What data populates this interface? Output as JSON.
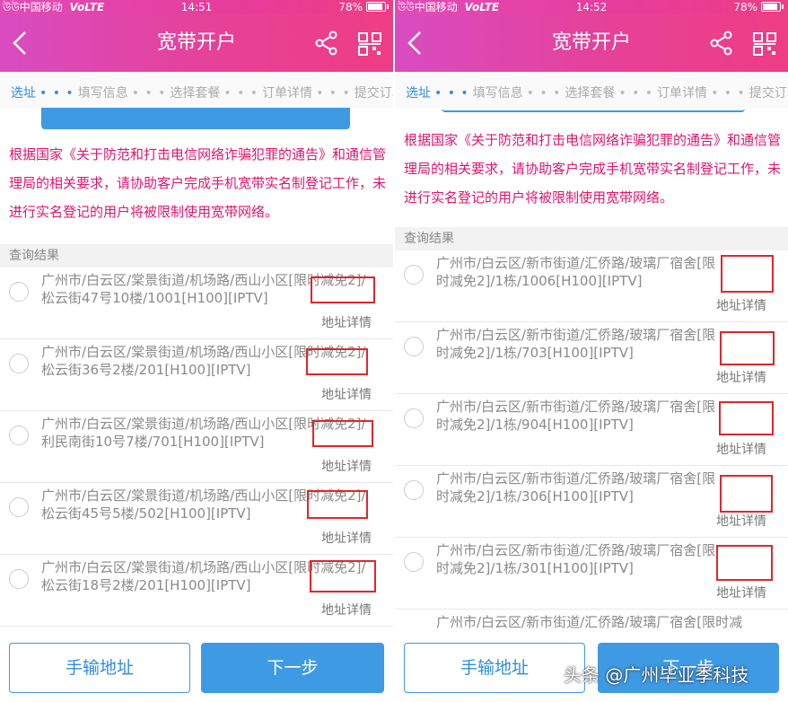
{
  "left": {
    "status": {
      "signal": "উউ中国移动",
      "network": "VoLTE",
      "time": "14:51",
      "battery": "78%"
    },
    "title": "宽带开户",
    "steps": [
      "选址",
      "填写信息",
      "选择套餐",
      "订单详情",
      "提交订单"
    ],
    "notice": "根据国家《关于防范和打击电信网络诈骗犯罪的通告》和通信管理局的相关要求，请协助客户完成手机宽带实名制登记工作，未进行实名登记的用户将被限制使用宽带网络。",
    "results_label": "查询结果",
    "addresses": [
      {
        "text": "广州市/白云区/棠景街道/机场路/西山小区[限时减免2]/松云街47号10楼/1001[H100][IPTV]",
        "detail": "地址详情"
      },
      {
        "text": "广州市/白云区/棠景街道/机场路/西山小区[限时减免2]/松云街36号2楼/201[H100][IPTV]",
        "detail": "地址详情"
      },
      {
        "text": "广州市/白云区/棠景街道/机场路/西山小区[限时减免2]/利民南街10号7楼/701[H100][IPTV]",
        "detail": "地址详情"
      },
      {
        "text": "广州市/白云区/棠景街道/机场路/西山小区[限时减免2]/松云街45号5楼/502[H100][IPTV]",
        "detail": "地址详情"
      },
      {
        "text": "广州市/白云区/棠景街道/机场路/西山小区[限时减免2]/松云街18号2楼/201[H100][IPTV]",
        "detail": "地址详情"
      }
    ],
    "manual_button": "手输地址",
    "next_button": "下一步"
  },
  "right": {
    "status": {
      "signal": "উউ中国移动",
      "network": "VoLTE",
      "time": "14:52",
      "battery": "78%"
    },
    "title": "宽带开户",
    "steps": [
      "选址",
      "填写信息",
      "选择套餐",
      "订单详情",
      "提交订单"
    ],
    "notice": "根据国家《关于防范和打击电信网络诈骗犯罪的通告》和通信管理局的相关要求，请协助客户完成手机宽带实名制登记工作，未进行实名登记的用户将被限制使用宽带网络。",
    "results_label": "查询结果",
    "addresses": [
      {
        "text": "广州市/白云区/新市街道/汇侨路/玻璃厂宿舍[限时减免2]/1栋/1006[H100][IPTV]",
        "detail": "地址详情"
      },
      {
        "text": "广州市/白云区/新市街道/汇侨路/玻璃厂宿舍[限时减免2]/1栋/703[H100][IPTV]",
        "detail": "地址详情"
      },
      {
        "text": "广州市/白云区/新市街道/汇侨路/玻璃厂宿舍[限时减免2]/1栋/904[H100][IPTV]",
        "detail": "地址详情"
      },
      {
        "text": "广州市/白云区/新市街道/汇侨路/玻璃厂宿舍[限时减免2]/1栋/306[H100][IPTV]",
        "detail": "地址详情"
      },
      {
        "text": "广州市/白云区/新市街道/汇侨路/玻璃厂宿舍[限时减免2]/1栋/301[H100][IPTV]",
        "detail": "地址详情"
      },
      {
        "text": "广州市/白云区/新市街道/汇侨路/玻璃厂宿舍[限时减",
        "detail": ""
      }
    ],
    "manual_button": "手输地址",
    "next_button": "下一步"
  },
  "watermark": "头条 @广州毕业季科技",
  "colors": {
    "header_start": "#d84cc1",
    "header_end": "#ee3d84",
    "accent_blue": "#3f9ae4",
    "notice_red": "#e1146c",
    "highlight": "#e0262b"
  }
}
